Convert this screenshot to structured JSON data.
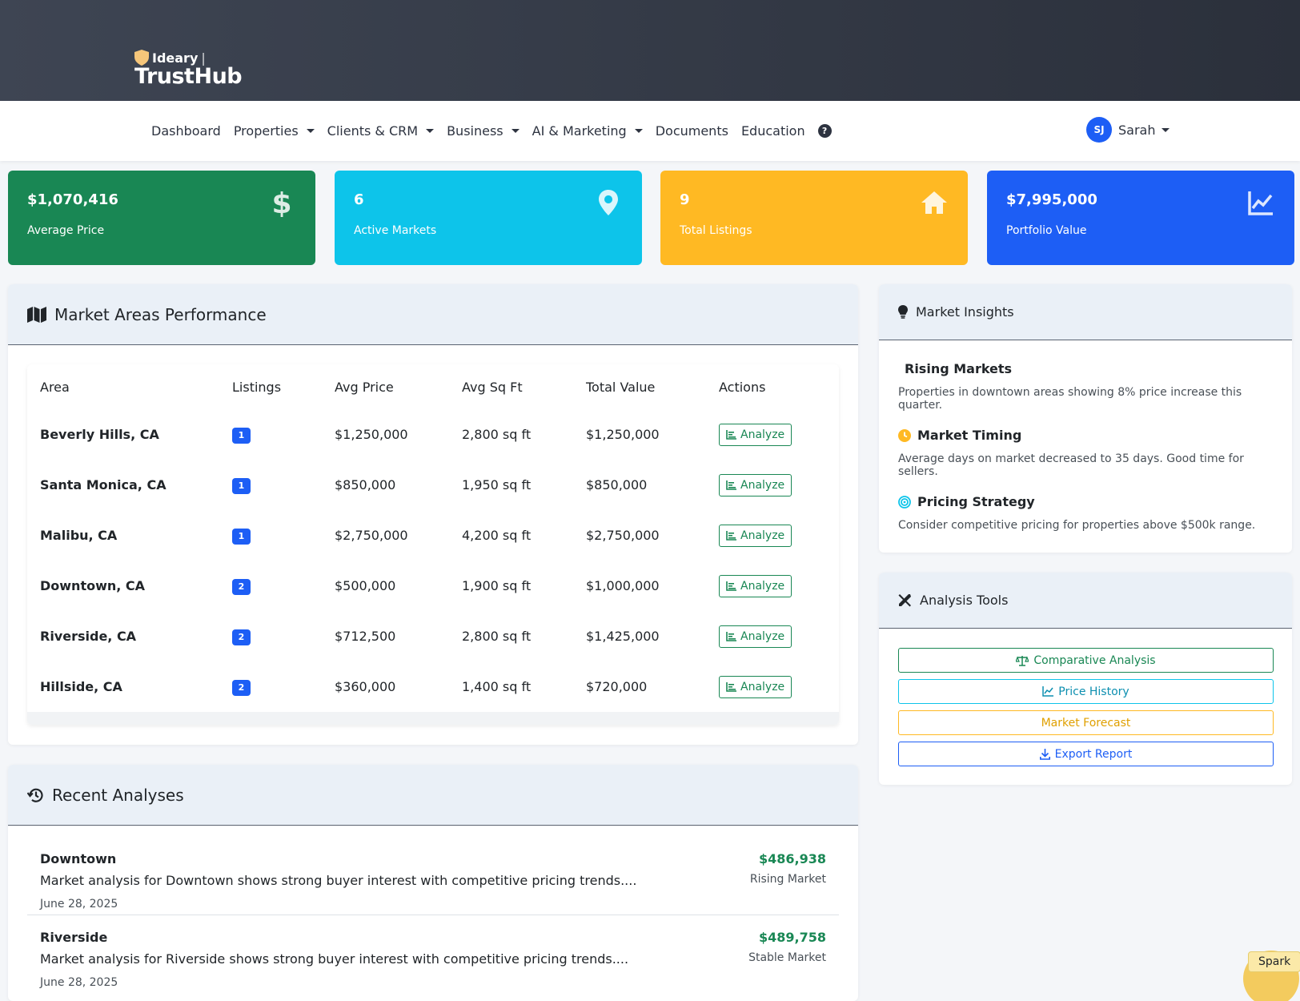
{
  "brand": {
    "small": "Ideary",
    "name": "TrustHub"
  },
  "nav": {
    "items": [
      {
        "label": "Dashboard",
        "dropdown": false
      },
      {
        "label": "Properties",
        "dropdown": true
      },
      {
        "label": "Clients & CRM",
        "dropdown": true
      },
      {
        "label": "Business",
        "dropdown": true
      },
      {
        "label": "AI & Marketing",
        "dropdown": true
      },
      {
        "label": "Documents",
        "dropdown": false
      },
      {
        "label": "Education",
        "dropdown": false
      }
    ],
    "help_icon": "?",
    "user": {
      "initials": "SJ",
      "name": "Sarah"
    }
  },
  "stats": [
    {
      "value": "$1,070,416",
      "label": "Average Price",
      "color": "#198754",
      "icon": "dollar-icon"
    },
    {
      "value": "6",
      "label": "Active Markets",
      "color": "#0dcaf0",
      "icon": "map-pin-icon"
    },
    {
      "value": "9",
      "label": "Total Listings",
      "color": "#ffc107",
      "icon": "house-icon"
    },
    {
      "value": "$7,995,000",
      "label": "Portfolio Value",
      "color": "#0d6efd",
      "icon": "chart-line-icon"
    }
  ],
  "market_areas": {
    "title": "Market Areas Performance",
    "columns": [
      "Area",
      "Listings",
      "Avg Price",
      "Avg Sq Ft",
      "Total Value",
      "Actions"
    ],
    "action_label": "Analyze",
    "rows": [
      {
        "area": "Beverly Hills, CA",
        "listings": "1",
        "avg_price": "$1,250,000",
        "avg_sqft": "2,800 sq ft",
        "total": "$1,250,000"
      },
      {
        "area": "Santa Monica, CA",
        "listings": "1",
        "avg_price": "$850,000",
        "avg_sqft": "1,950 sq ft",
        "total": "$850,000"
      },
      {
        "area": "Malibu, CA",
        "listings": "1",
        "avg_price": "$2,750,000",
        "avg_sqft": "4,200 sq ft",
        "total": "$2,750,000"
      },
      {
        "area": "Downtown, CA",
        "listings": "2",
        "avg_price": "$500,000",
        "avg_sqft": "1,900 sq ft",
        "total": "$1,000,000"
      },
      {
        "area": "Riverside, CA",
        "listings": "2",
        "avg_price": "$712,500",
        "avg_sqft": "2,800 sq ft",
        "total": "$1,425,000"
      },
      {
        "area": "Hillside, CA",
        "listings": "2",
        "avg_price": "$360,000",
        "avg_sqft": "1,400 sq ft",
        "total": "$720,000"
      }
    ]
  },
  "insights": {
    "title": "Market Insights",
    "items": [
      {
        "title": "Rising Markets",
        "text": "Properties in downtown areas showing 8% price increase this quarter.",
        "icon": ""
      },
      {
        "title": "Market Timing",
        "text": "Average days on market decreased to 35 days. Good time for sellers.",
        "icon": "clock-icon"
      },
      {
        "title": "Pricing Strategy",
        "text": "Consider competitive pricing for properties above $500k range.",
        "icon": "target-icon"
      }
    ]
  },
  "tools": {
    "title": "Analysis Tools",
    "buttons": [
      {
        "label": "Comparative Analysis",
        "color": "#198754",
        "icon": "balance-scale-icon"
      },
      {
        "label": "Price History",
        "color": "#0dcaf0",
        "icon": "chart-line-icon"
      },
      {
        "label": "Market Forecast",
        "color": "#ffc107",
        "icon": ""
      },
      {
        "label": "Export Report",
        "color": "#0d6efd",
        "icon": "download-icon"
      }
    ]
  },
  "recent": {
    "title": "Recent Analyses",
    "items": [
      {
        "title": "Downtown",
        "desc": "Market analysis for Downtown shows strong buyer interest with competitive pricing trends....",
        "date": "June 28, 2025",
        "value": "$486,938",
        "status": "Rising Market"
      },
      {
        "title": "Riverside",
        "desc": "Market analysis for Riverside shows strong buyer interest with competitive pricing trends....",
        "date": "June 28, 2025",
        "value": "$489,758",
        "status": "Stable Market"
      }
    ]
  },
  "spark": {
    "label": "Spark"
  }
}
